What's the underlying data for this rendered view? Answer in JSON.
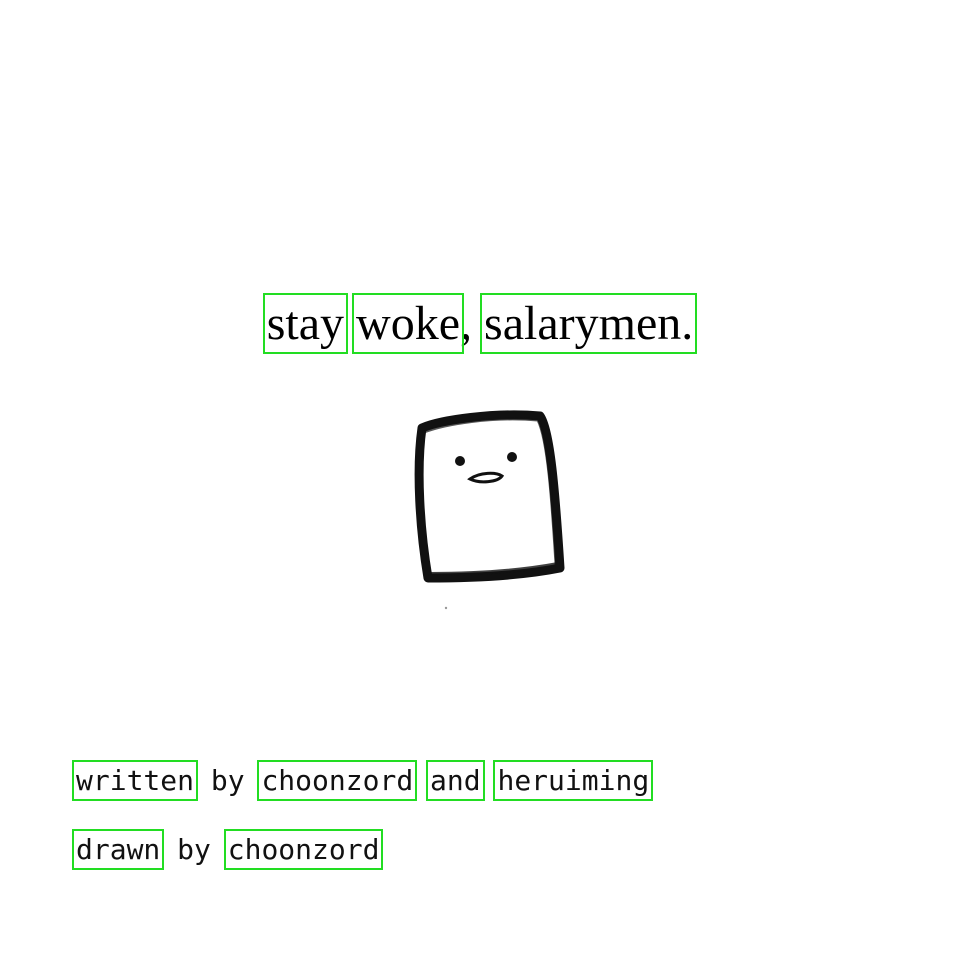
{
  "title": {
    "words": [
      "stay",
      "woke",
      "salarymen."
    ],
    "separators": [
      " ",
      ", "
    ]
  },
  "credits": {
    "written": {
      "verb": "written",
      "by": " by ",
      "author1": "choonzord",
      "and": "and",
      "author2": "heruiming"
    },
    "drawn": {
      "verb": "drawn",
      "by": " by ",
      "author": "choonzord"
    }
  },
  "illustration": {
    "subject": "sketched-box-character-icon"
  },
  "colors": {
    "highlight": "#22dd22",
    "text": "#111111",
    "background": "#ffffff"
  }
}
